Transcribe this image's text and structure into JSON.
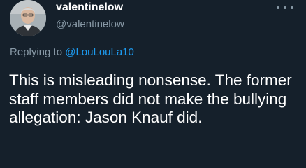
{
  "tweet": {
    "display_name": "valentinelow",
    "handle": "@valentinelow",
    "replying_prefix": "Replying to",
    "replying_to": "@LouLouLa10",
    "text": "This is misleading nonsense. The former staff members did not make the bullying allegation: Jason Knauf did.",
    "more_icon": "more-horizontal-icon"
  },
  "colors": {
    "background": "#15202b",
    "text": "#ffffff",
    "secondary": "#8899a6",
    "link": "#1d9bf0"
  }
}
